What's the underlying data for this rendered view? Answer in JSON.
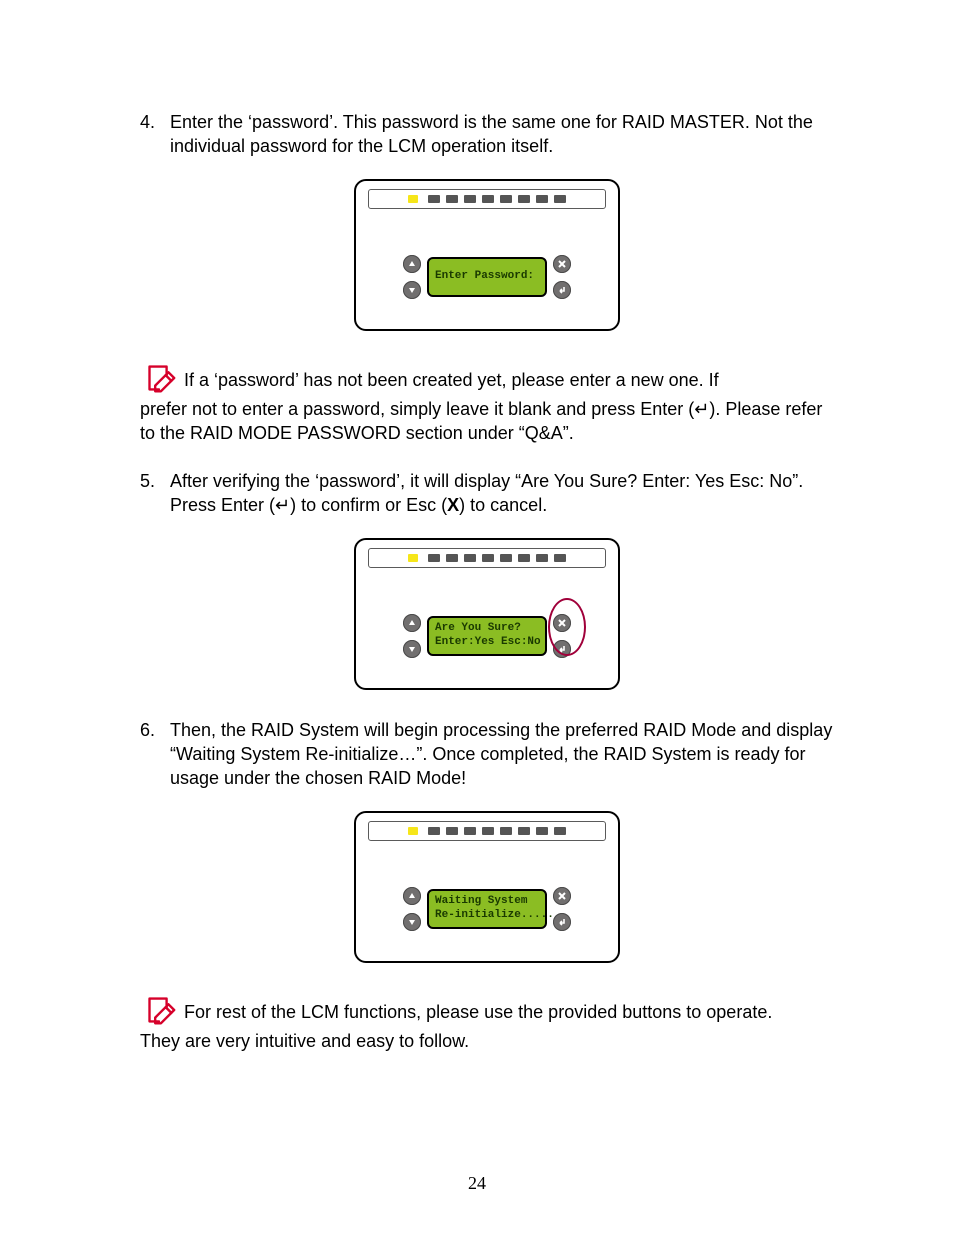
{
  "pageNumber": "24",
  "steps": {
    "s4": {
      "num": "4.",
      "text": "Enter the ‘password’.  This password is the same one for RAID MASTER. Not the individual password for the LCM operation itself."
    },
    "s5": {
      "num": "5.",
      "prefix": "After verifying the ‘password’, it will display “Are You Sure? Enter: Yes Esc: No”.  Press Enter (↵) to confirm or Esc (",
      "boldX": "X",
      "suffix": ") to cancel."
    },
    "s6": {
      "num": "6.",
      "text": "Then, the RAID System will begin processing the preferred RAID Mode and display “Waiting System Re-initialize…”.  Once completed, the RAID System is ready for usage under the chosen RAID Mode!"
    }
  },
  "notes": {
    "n1": {
      "first": "If a ‘password’ has not been created yet, please enter a new one.  If",
      "rest": "prefer not to enter a password, simply leave it blank and press Enter (↵).  Please refer to the RAID MODE PASSWORD section under “Q&A”."
    },
    "n2": {
      "first": "For rest of the LCM functions, please use the provided buttons to operate.",
      "rest": "They are very intuitive and easy to follow."
    }
  },
  "lcd": {
    "password": {
      "l1": "Enter Password:",
      "l2": ""
    },
    "confirm": {
      "l1": "Are You Sure?",
      "l2": "Enter:Yes Esc:No"
    },
    "wait": {
      "l1": "Waiting System",
      "l2": "Re-initialize....."
    }
  }
}
